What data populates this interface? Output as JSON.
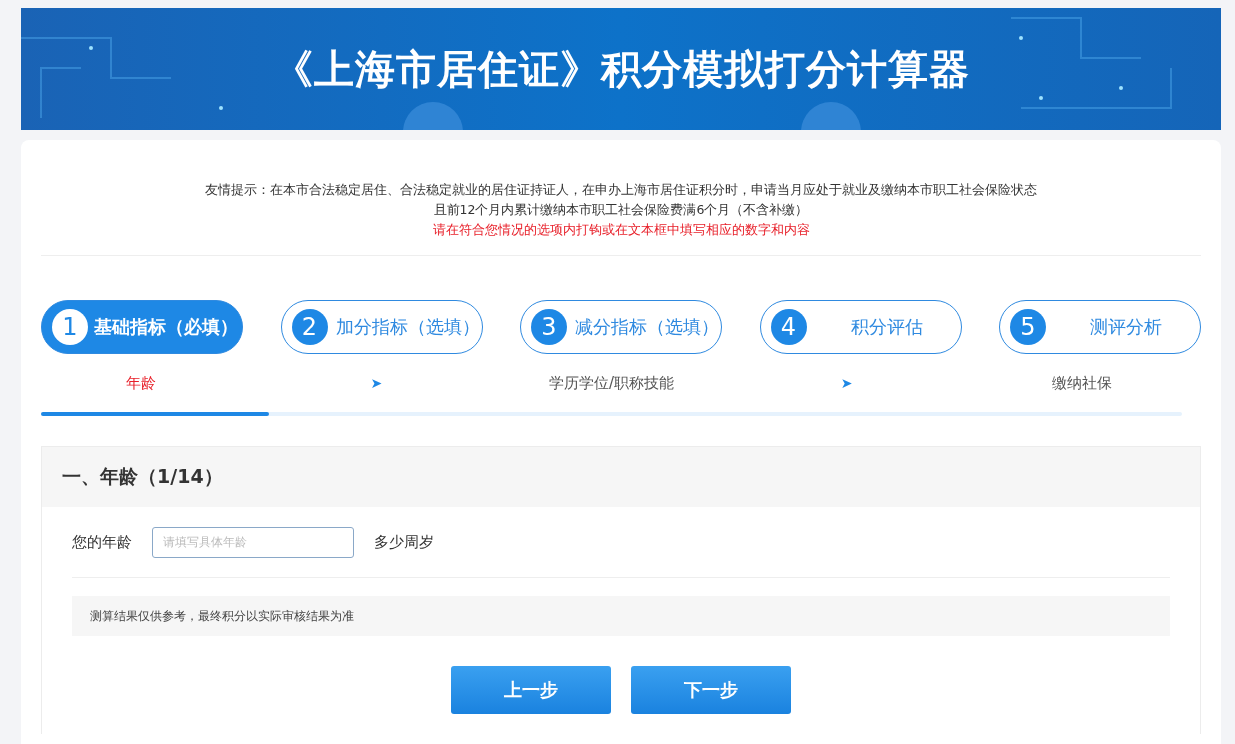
{
  "banner": {
    "title": "《上海市居住证》积分模拟打分计算器"
  },
  "notice": {
    "lines": [
      "友情提示：在本市合法稳定居住、合法稳定就业的居住证持证人，在申办上海市居住证积分时，申请当月应处于就业及缴纳本市职工社会保险状态",
      "且前12个月内累计缴纳本市职工社会保险费满6个月（不含补缴）"
    ],
    "highlight": "请在符合您情况的选项内打钩或在文本框中填写相应的数字和内容"
  },
  "steps": [
    {
      "number": "1",
      "label": "基础指标（必填）",
      "selected": true
    },
    {
      "number": "2",
      "label": "加分指标（选填）",
      "selected": false
    },
    {
      "number": "3",
      "label": "减分指标（选填）",
      "selected": false
    },
    {
      "number": "4",
      "label": "积分评估",
      "selected": false
    },
    {
      "number": "5",
      "label": "测评分析",
      "selected": false
    }
  ],
  "substeps": [
    {
      "kind": "step",
      "label": "年龄",
      "selected": true
    },
    {
      "kind": "arrow",
      "label": "➤"
    },
    {
      "kind": "step",
      "label": "学历学位/职称技能",
      "selected": false
    },
    {
      "kind": "arrow",
      "label": "➤"
    },
    {
      "kind": "step",
      "label": "缴纳社保",
      "selected": false
    }
  ],
  "progress": {
    "level": 0.2
  },
  "section": {
    "title": "一、年龄（1/14）",
    "field_label": "您的年龄",
    "placeholder": "请填写具体年龄",
    "unit": "多少周岁",
    "note": "测算结果仅供参考，最终积分以实际审核结果为准"
  },
  "buttons": [
    "上一步",
    "下一步"
  ]
}
